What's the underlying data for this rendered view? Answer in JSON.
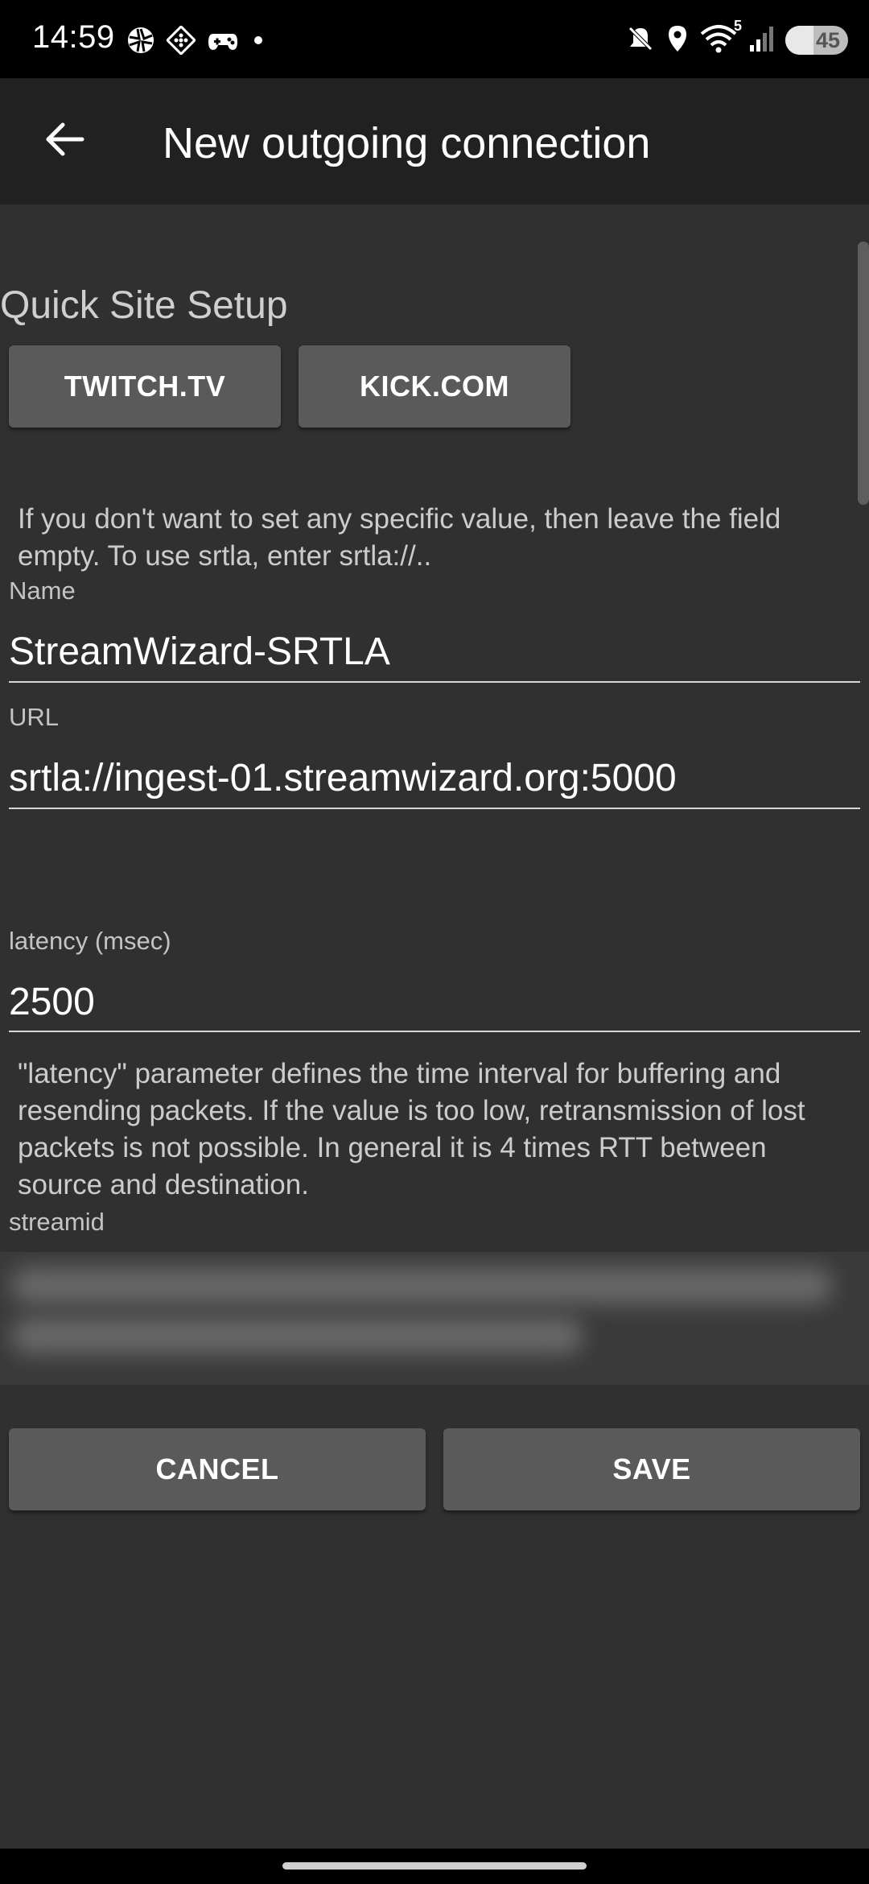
{
  "status_bar": {
    "time": "14:59",
    "battery_percent": 45,
    "battery_text": "45",
    "left_icons": [
      "aperture-icon",
      "diamond-grid-icon",
      "gamepad-icon",
      "notification-dot-icon"
    ],
    "right_icons": [
      "mute-icon",
      "location-icon",
      "wifi-icon",
      "signal-icon",
      "battery-icon"
    ],
    "wifi_badge": "5"
  },
  "app_bar": {
    "title": "New outgoing connection",
    "back_icon": "arrow-back-icon"
  },
  "quick_setup": {
    "title": "Quick Site Setup",
    "buttons": [
      {
        "label": "TWITCH.TV"
      },
      {
        "label": "KICK.COM"
      }
    ]
  },
  "form": {
    "hint": "If you don't want to set any specific value, then leave the field empty. To use srtla, enter srtla://..",
    "name": {
      "label": "Name",
      "value": "StreamWizard-SRTLA"
    },
    "url": {
      "label": "URL",
      "value": "srtla://ingest-01.streamwizard.org:5000"
    },
    "latency": {
      "label": "latency (msec)",
      "value": "2500",
      "help": "\"latency\" parameter defines the time interval for buffering and resending packets. If the value is too low, retransmission of lost packets is not possible. In general it is 4 times RTT between source and destination."
    },
    "streamid": {
      "label": "streamid"
    }
  },
  "actions": {
    "cancel_label": "CANCEL",
    "save_label": "SAVE"
  },
  "colors": {
    "background": "#303030",
    "app_bar": "#212121",
    "button": "#5a5a5a",
    "status_bar": "#000000"
  }
}
